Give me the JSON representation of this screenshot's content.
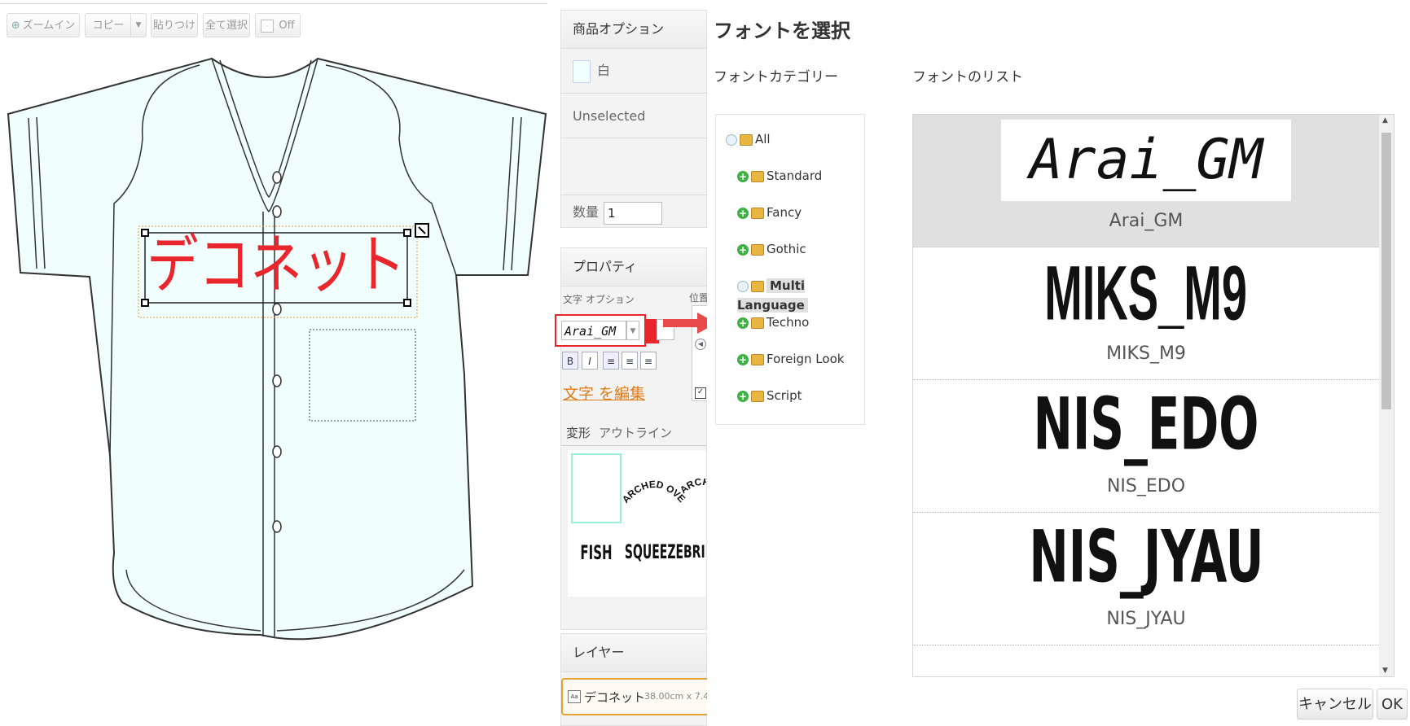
{
  "toolbar": {
    "zoom_in": "ズームイン",
    "copy": "コピー",
    "paste": "貼りつけ",
    "select_all": "全て選択",
    "off": "Off"
  },
  "canvas": {
    "design_text": "デコネット",
    "design_text_color": "#e8262c",
    "shirt_fill": "#f0fefe"
  },
  "product_options": {
    "title": "商品オプション",
    "color_label": "白",
    "unselected": "Unselected",
    "quantity_label": "数量",
    "quantity_value": "1"
  },
  "properties": {
    "title": "プロパティ",
    "text_options_label": "文字 オプション",
    "position_label": "位置",
    "font_value": "Arai_GM",
    "bold": "B",
    "italic": "I",
    "edit_text_link": "文字 を編集",
    "tab_transform": "変形",
    "tab_outline": "アウトライン",
    "effects": [
      "ARCHED OVER",
      "ARCHED",
      "FISH EYE",
      "SQUEEZE",
      "BRID"
    ]
  },
  "layers": {
    "title": "レイヤー",
    "item_name": "デコネット",
    "item_size": "38.00cm x 7.4"
  },
  "font_dialog": {
    "title": "フォントを選択",
    "category_label": "フォントカテゴリー",
    "list_label": "フォントのリスト",
    "categories": [
      "All",
      "Standard",
      "Fancy",
      "Gothic",
      "Multi Language",
      "Techno",
      "Foreign Look",
      "Script"
    ],
    "selected_category": "Multi Language",
    "fonts": [
      {
        "name": "Arai_GM",
        "preview": "Arai_GM"
      },
      {
        "name": "MIKS_M9",
        "preview": "MIKS_M9"
      },
      {
        "name": "NIS_EDO",
        "preview": "NIS_EDO"
      },
      {
        "name": "NIS_JYAU",
        "preview": "NIS_JYAU"
      }
    ],
    "cancel": "キャンセル",
    "ok": "OK"
  },
  "colors": {
    "highlight_red": "#e8262c",
    "edit_link_orange": "#e07b1a",
    "selected_row_bg": "#e0e0e0"
  }
}
